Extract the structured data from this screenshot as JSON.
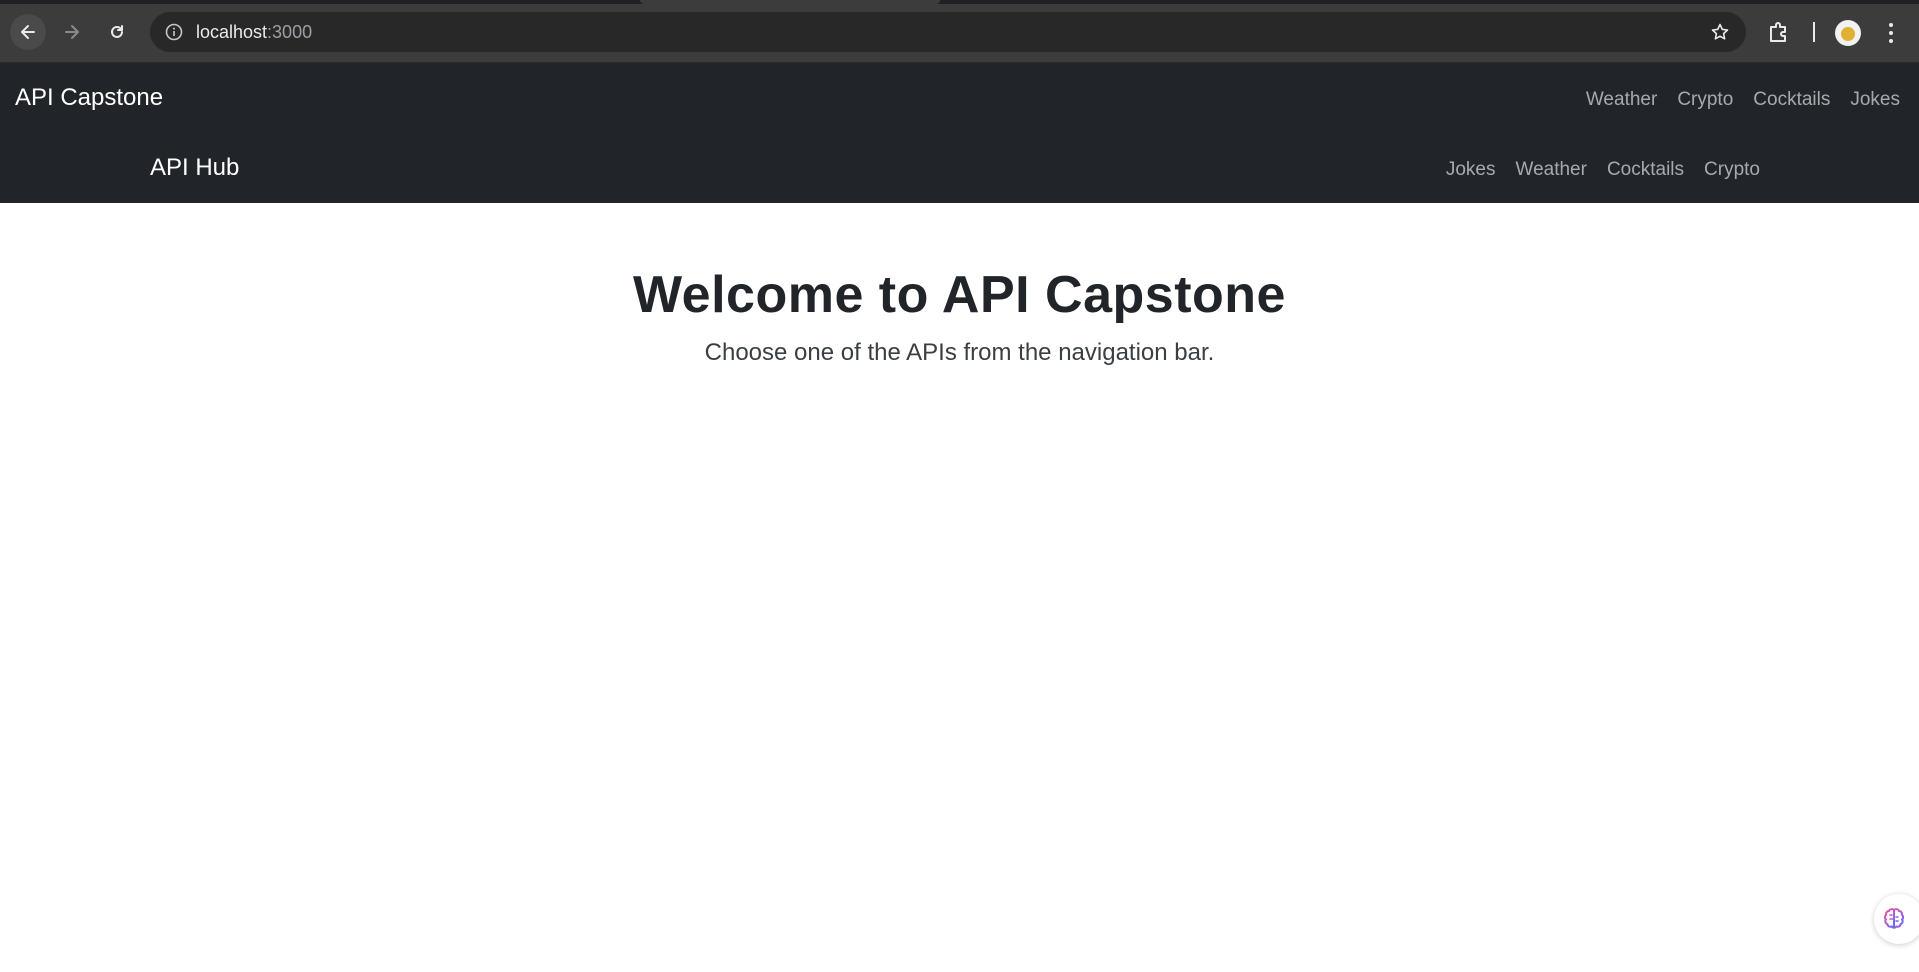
{
  "browser": {
    "url_host": "localhost",
    "url_port": ":3000",
    "colors": {
      "chrome_bg": "#3c3c3c",
      "omnibox_bg": "#282828"
    }
  },
  "navbar_primary": {
    "brand": "API Capstone",
    "links": [
      "Weather",
      "Crypto",
      "Cocktails",
      "Jokes"
    ]
  },
  "navbar_secondary": {
    "brand": "API Hub",
    "links": [
      "Jokes",
      "Weather",
      "Cocktails",
      "Crypto"
    ]
  },
  "main": {
    "title": "Welcome to API Capstone",
    "subtitle": "Choose one of the APIs from the navigation bar."
  },
  "colors": {
    "navbar_bg": "#212529",
    "link": "#a7aaad",
    "text": "#212529"
  },
  "icons": [
    "back-arrow-icon",
    "forward-arrow-icon",
    "reload-icon",
    "site-info-icon",
    "bookmark-star-icon",
    "extensions-icon",
    "profile-avatar",
    "kebab-menu-icon",
    "brain-widget-icon"
  ]
}
